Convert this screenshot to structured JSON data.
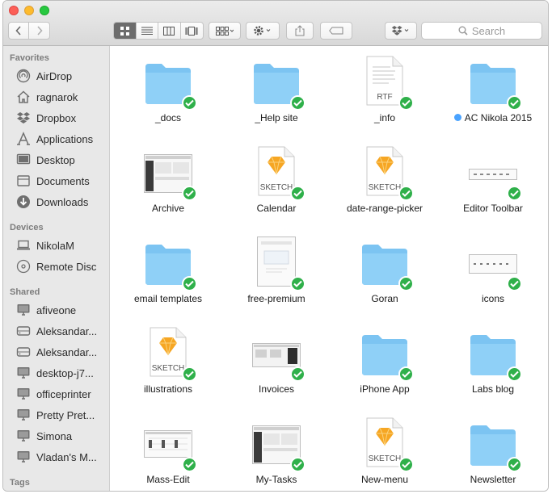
{
  "window": {
    "title": ""
  },
  "toolbar": {
    "search_placeholder": "Search",
    "back_icon": "chevron-left-icon",
    "forward_icon": "chevron-right-icon",
    "view_modes": [
      "icon-view",
      "list-view",
      "column-view",
      "coverflow-view"
    ],
    "active_view": "icon-view"
  },
  "sidebar": {
    "favorites_title": "Favorites",
    "favorites": [
      {
        "label": "AirDrop",
        "icon": "airdrop-icon"
      },
      {
        "label": "ragnarok",
        "icon": "home-icon"
      },
      {
        "label": "Dropbox",
        "icon": "dropbox-icon"
      },
      {
        "label": "Applications",
        "icon": "applications-icon"
      },
      {
        "label": "Desktop",
        "icon": "desktop-icon"
      },
      {
        "label": "Documents",
        "icon": "documents-icon"
      },
      {
        "label": "Downloads",
        "icon": "downloads-icon"
      }
    ],
    "devices_title": "Devices",
    "devices": [
      {
        "label": "NikolaM",
        "icon": "laptop-icon"
      },
      {
        "label": "Remote Disc",
        "icon": "disc-icon"
      }
    ],
    "shared_title": "Shared",
    "shared": [
      {
        "label": "afiveone",
        "icon": "monitor-icon"
      },
      {
        "label": "Aleksandar...",
        "icon": "server-icon"
      },
      {
        "label": "Aleksandar...",
        "icon": "server-icon"
      },
      {
        "label": "desktop-j7...",
        "icon": "monitor-icon"
      },
      {
        "label": "officeprinter",
        "icon": "monitor-icon"
      },
      {
        "label": "Pretty Pret...",
        "icon": "monitor-icon"
      },
      {
        "label": "Simona",
        "icon": "monitor-icon"
      },
      {
        "label": "Vladan's M...",
        "icon": "monitor-icon"
      }
    ],
    "tags_title": "Tags"
  },
  "files": [
    {
      "label": "_docs",
      "kind": "folder",
      "synced": true
    },
    {
      "label": "_Help site",
      "kind": "folder",
      "synced": true
    },
    {
      "label": "_info",
      "kind": "rtf",
      "badge": "RTF",
      "synced": true
    },
    {
      "label": "AC Nikola 2015",
      "kind": "folder",
      "synced": true,
      "tag_color": "#4aa3ff"
    },
    {
      "label": "Archive",
      "kind": "screenshot",
      "synced": true
    },
    {
      "label": "Calendar",
      "kind": "sketch",
      "badge": "SKETCH",
      "synced": true
    },
    {
      "label": "date-range-picker",
      "kind": "sketch",
      "badge": "SKETCH",
      "synced": true
    },
    {
      "label": "Editor Toolbar",
      "kind": "strip",
      "synced": true
    },
    {
      "label": "email templates",
      "kind": "folder",
      "synced": true
    },
    {
      "label": "free-premium",
      "kind": "doc",
      "synced": true
    },
    {
      "label": "Goran",
      "kind": "folder",
      "synced": true
    },
    {
      "label": "icons",
      "kind": "strip2",
      "synced": true
    },
    {
      "label": "illustrations",
      "kind": "sketch",
      "badge": "SKETCH",
      "synced": true
    },
    {
      "label": "Invoices",
      "kind": "screenshot2",
      "synced": true
    },
    {
      "label": "iPhone App",
      "kind": "folder",
      "synced": true
    },
    {
      "label": "Labs blog",
      "kind": "folder",
      "synced": true
    },
    {
      "label": "Mass-Edit",
      "kind": "screenshot3",
      "synced": true
    },
    {
      "label": "My-Tasks",
      "kind": "screenshot",
      "synced": true
    },
    {
      "label": "New-menu",
      "kind": "sketch",
      "badge": "SKETCH",
      "synced": true
    },
    {
      "label": "Newsletter",
      "kind": "folder",
      "synced": true
    }
  ],
  "colors": {
    "folder": "#7cc4f2",
    "sync_check": "#2fb04a",
    "sketch": "#f6a623"
  }
}
